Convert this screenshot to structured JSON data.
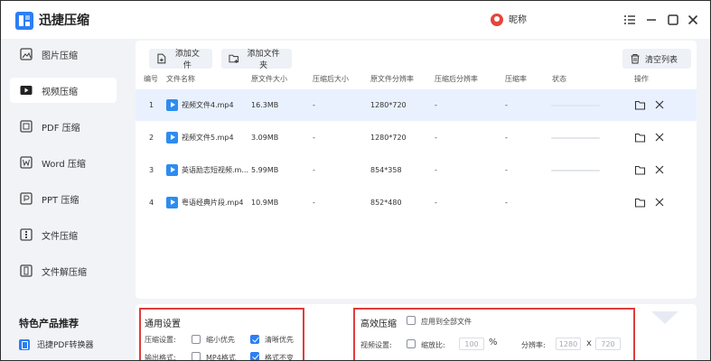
{
  "app": {
    "title": "迅捷压缩",
    "user_name": "昵称",
    "brand_color": "#2d7ef5",
    "highlight_color": "#e03c3c"
  },
  "sidebar": {
    "items": [
      {
        "label": "图片压缩",
        "icon": "image-compress-icon",
        "active": false
      },
      {
        "label": "视频压缩",
        "icon": "video-compress-icon",
        "active": true
      },
      {
        "label": "PDF 压缩",
        "icon": "pdf-compress-icon",
        "active": false
      },
      {
        "label": "Word 压缩",
        "icon": "word-compress-icon",
        "active": false
      },
      {
        "label": "PPT 压缩",
        "icon": "ppt-compress-icon",
        "active": false
      },
      {
        "label": "文件压缩",
        "icon": "file-compress-icon",
        "active": false
      },
      {
        "label": "文件解压缩",
        "icon": "file-decompress-icon",
        "active": false
      }
    ],
    "featured_heading": "特色产品推荐",
    "featured_item": "迅捷PDF转换器"
  },
  "toolbar": {
    "add_file": "添加文件",
    "add_folder": "添加文件夹",
    "clear_list": "清空列表"
  },
  "table": {
    "headers": [
      "编号",
      "文件名称",
      "原文件大小",
      "压缩后大小",
      "原文件分辨率",
      "压缩后分辨率",
      "压缩率",
      "状态",
      "操作"
    ],
    "rows": [
      {
        "index": "1",
        "name": "视频文件4.mp4",
        "orig_size": "16.3MB",
        "new_size": "-",
        "orig_res": "1280*720",
        "new_res": "-",
        "ratio": "-",
        "selected": true
      },
      {
        "index": "2",
        "name": "视频文件5.mp4",
        "orig_size": "3.09MB",
        "new_size": "-",
        "orig_res": "1280*720",
        "new_res": "-",
        "ratio": "-",
        "selected": false
      },
      {
        "index": "3",
        "name": "英语励志短视频.m...",
        "orig_size": "5.99MB",
        "new_size": "-",
        "orig_res": "854*358",
        "new_res": "-",
        "ratio": "-",
        "selected": false
      },
      {
        "index": "4",
        "name": "粤语经典片段.mp4",
        "orig_size": "10.9MB",
        "new_size": "-",
        "orig_res": "852*480",
        "new_res": "-",
        "ratio": "-",
        "selected": false
      }
    ]
  },
  "general_settings": {
    "title": "通用设置",
    "compress_label": "压缩设置:",
    "opt_small": "缩小优先",
    "opt_clear": "清晰优先",
    "output_label": "输出格式:",
    "opt_mp4": "MP4格式",
    "opt_keep": "格式不变"
  },
  "efficient": {
    "title": "高效压缩",
    "apply_all": "应用到全部文件",
    "video_label": "视频设置:",
    "scale_label": "缩放比:",
    "scale_value": "100",
    "percent": "%",
    "res_label": "分辨率:",
    "res_w": "1280",
    "x": "x",
    "res_h": "720"
  }
}
